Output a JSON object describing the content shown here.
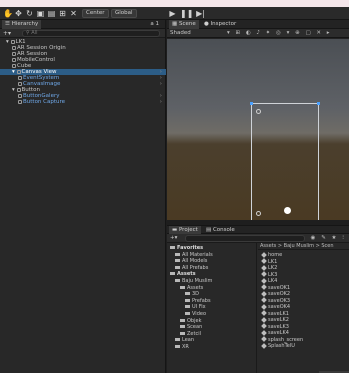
{
  "toolbar": {
    "center_label": "Center",
    "global_label": "Global"
  },
  "hierarchy": {
    "tab": "Hierarchy",
    "count": "a 1",
    "search_placeholder": "All",
    "items": [
      {
        "label": "LK1",
        "indent": 0,
        "type": "scene"
      },
      {
        "label": "AR Session Origin",
        "indent": 1
      },
      {
        "label": "AR Session",
        "indent": 1
      },
      {
        "label": "MobileControl",
        "indent": 1
      },
      {
        "label": "Cube",
        "indent": 1
      },
      {
        "label": "Canvas View",
        "indent": 1,
        "selected": true
      },
      {
        "label": "EventSystem",
        "indent": 2,
        "blue": true
      },
      {
        "label": "CanvasImage",
        "indent": 2,
        "blue": true
      },
      {
        "label": "Button",
        "indent": 1
      },
      {
        "label": "ButtonGalery",
        "indent": 2,
        "blue": true
      },
      {
        "label": "Button Capture",
        "indent": 2,
        "blue": true
      }
    ]
  },
  "scene": {
    "tab_scene": "Scene",
    "tab_inspector": "Inspector",
    "shading": "Shaded"
  },
  "project": {
    "tab_project": "Project",
    "tab_console": "Console",
    "breadcrumb": "Assets > Baju Muslim > Scen",
    "tree": [
      {
        "label": "Favorites",
        "indent": 0,
        "bold": true
      },
      {
        "label": "All Materials",
        "indent": 1
      },
      {
        "label": "All Models",
        "indent": 1
      },
      {
        "label": "All Prefabs",
        "indent": 1
      },
      {
        "label": "Assets",
        "indent": 0,
        "bold": true
      },
      {
        "label": "Baju Muslim",
        "indent": 1
      },
      {
        "label": "Assets",
        "indent": 2
      },
      {
        "label": "3D",
        "indent": 3
      },
      {
        "label": "Prefabs",
        "indent": 3
      },
      {
        "label": "UI Fix",
        "indent": 3
      },
      {
        "label": "Video",
        "indent": 3
      },
      {
        "label": "Objek",
        "indent": 2
      },
      {
        "label": "Scean",
        "indent": 2
      },
      {
        "label": "Zetcil",
        "indent": 2
      },
      {
        "label": "Lean",
        "indent": 1
      },
      {
        "label": "XR",
        "indent": 1
      }
    ],
    "files": [
      "home",
      "LK1",
      "LK2",
      "LK3",
      "LK4",
      "saveOK1",
      "saveOK2",
      "saveOK3",
      "saveOK4",
      "saveLK1",
      "saveLK2",
      "saveLK3",
      "saveLK4",
      "splash_screen",
      "SplashTelU"
    ]
  }
}
